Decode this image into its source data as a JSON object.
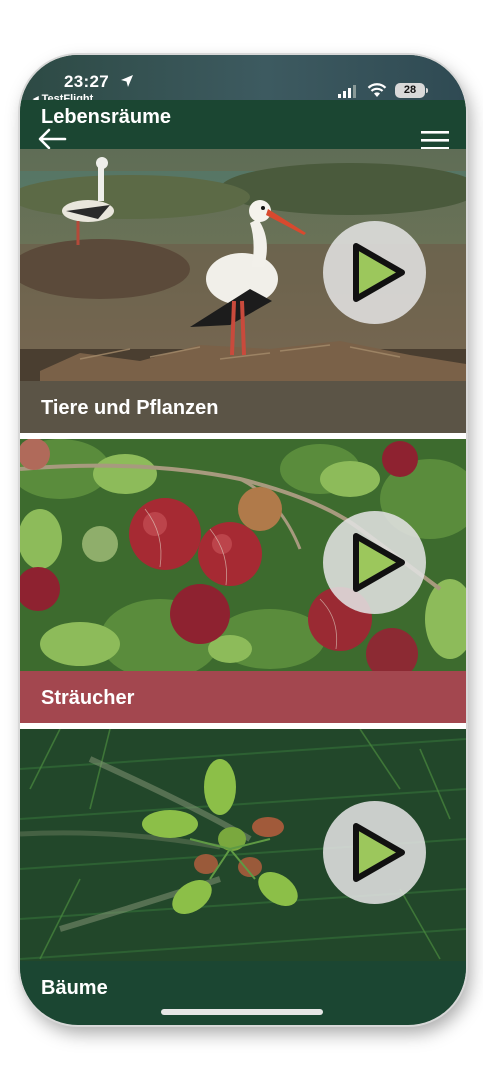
{
  "status_bar": {
    "time": "23:27",
    "back_app": "◂ TestFlight",
    "battery": "28"
  },
  "header": {
    "title": "Lebensräume"
  },
  "cards": [
    {
      "label": "Tiere und Pflanzen",
      "label_bg": "#5b5446",
      "image": "white-stork-on-nest"
    },
    {
      "label": "Sträucher",
      "label_bg": "#a3474f",
      "image": "red-gooseberries-on-branch"
    },
    {
      "label": "Bäume",
      "label_bg": "#1b4632",
      "image": "fir-branch-with-new-shoots"
    }
  ],
  "colors": {
    "primary_green": "#1b4632",
    "play_triangle": "#9cc75c"
  }
}
